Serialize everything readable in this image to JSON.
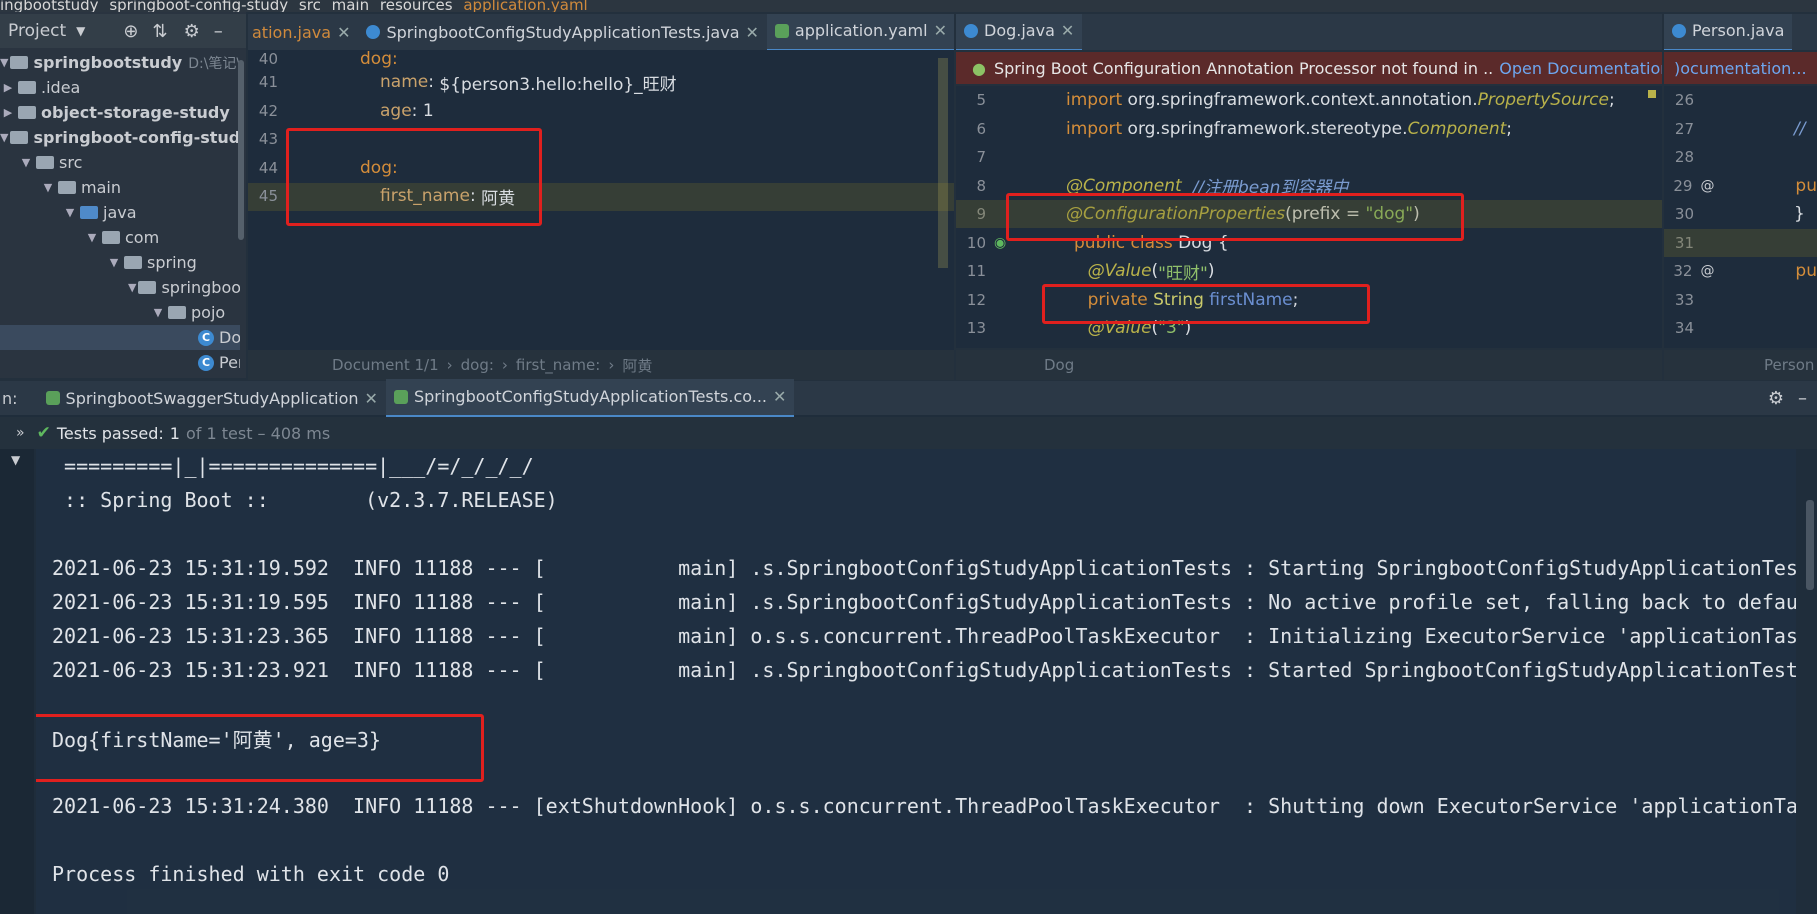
{
  "breadcrumb": [
    "ingbootstudy",
    "springboot-config-study",
    "src",
    "main",
    "resources",
    "application.yaml"
  ],
  "project": {
    "header": "Project",
    "tree": [
      {
        "label": "springbootstudy",
        "suffix": "D:\\笔记\\java\\",
        "type": "folder"
      },
      {
        "label": ".idea",
        "type": "folder"
      },
      {
        "label": "object-storage-study",
        "type": "folder"
      },
      {
        "label": "springboot-config-study",
        "type": "folder"
      },
      {
        "label": "src",
        "type": "folder"
      },
      {
        "label": "main",
        "type": "folder"
      },
      {
        "label": "java",
        "type": "folder"
      },
      {
        "label": "com",
        "type": "folder"
      },
      {
        "label": "spring",
        "type": "folder"
      },
      {
        "label": "springboo",
        "type": "folder"
      },
      {
        "label": "pojo",
        "type": "folder"
      },
      {
        "label": "Do",
        "type": "class"
      },
      {
        "label": "Per",
        "type": "class"
      }
    ]
  },
  "tabs_left": [
    {
      "label": "ation.java"
    },
    {
      "label": "SpringbootConfigStudyApplicationTests.java"
    },
    {
      "label": "application.yaml"
    }
  ],
  "tabs_left_more": "2",
  "tabs_mid": [
    {
      "label": "Dog.java"
    }
  ],
  "tabs_right": [
    {
      "label": "Person.java"
    }
  ],
  "yaml_editor": {
    "lines": [
      {
        "n": "40",
        "text": "dog:"
      },
      {
        "n": "41",
        "key": "name",
        "val": "${person3.hello:hello}_旺财"
      },
      {
        "n": "42",
        "key": "age",
        "val": "1"
      },
      {
        "n": "43",
        "text": ""
      },
      {
        "n": "44",
        "text": "dog:"
      },
      {
        "n": "45",
        "key": "first_name",
        "val": "阿黄"
      }
    ],
    "status": [
      "Document 1/1",
      "dog:",
      "first_name:",
      "阿黄"
    ]
  },
  "dog_editor": {
    "banner": "Spring Boot Configuration Annotation Processor not found in ..",
    "banner_link": "Open Documentation...",
    "lines": [
      {
        "n": "5",
        "a": "import ",
        "b": "org.springframework.context.annotation.",
        "c": "PropertySource",
        "d": ";"
      },
      {
        "n": "6",
        "a": "import ",
        "b": "org.springframework.stereotype.",
        "c": "Component",
        "d": ";"
      },
      {
        "n": "7"
      },
      {
        "n": "8",
        "ann": "@Component",
        "cmt": "  //注册bean到容器中"
      },
      {
        "n": "9",
        "ann": "@ConfigurationProperties",
        "rest": "(prefix = ",
        "str": "\"dog\"",
        "end": ")"
      },
      {
        "n": "10",
        "kw": "public class ",
        "plain": "Dog {"
      },
      {
        "n": "11",
        "ann": "    @Value",
        "rest": "(",
        "str": "\"旺财\"",
        "end": ")"
      },
      {
        "n": "12",
        "kw": "    private ",
        "plain": "String ",
        "fld": "firstName",
        "end": ";"
      },
      {
        "n": "13",
        "ann": "    @Value",
        "rest": "(",
        "str": "\"3\"",
        "end": ")"
      }
    ],
    "status": "Dog"
  },
  "person_editor": {
    "banner_link": ")ocumentation...",
    "lines": [
      {
        "n": "26",
        "code": ""
      },
      {
        "n": "27",
        "code": "//"
      },
      {
        "n": "28",
        "code": ""
      },
      {
        "n": "29",
        "code": "pu"
      },
      {
        "n": "30",
        "code": "}"
      },
      {
        "n": "31",
        "code": ""
      },
      {
        "n": "32",
        "code": "pu"
      },
      {
        "n": "33",
        "code": ""
      },
      {
        "n": "34",
        "code": ""
      }
    ],
    "status": "Person"
  },
  "run": {
    "prefix": "n:",
    "tabs": [
      "SpringbootSwaggerStudyApplication",
      "SpringbootConfigStudyApplicationTests.co..."
    ],
    "tests_passed": "Tests passed:",
    "count": "1",
    "of": "of 1 test – 408 ms",
    "console": [
      " =========|_|==============|___/=/_/_/_/",
      " :: Spring Boot ::        (v2.3.7.RELEASE)",
      "",
      "2021-06-23 15:31:19.592  INFO 11188 --- [           main] .s.SpringbootConfigStudyApplicationTests : Starting SpringbootConfigStudyApplicationTest",
      "2021-06-23 15:31:19.595  INFO 11188 --- [           main] .s.SpringbootConfigStudyApplicationTests : No active profile set, falling back to defaul",
      "2021-06-23 15:31:23.365  INFO 11188 --- [           main] o.s.s.concurrent.ThreadPoolTaskExecutor  : Initializing ExecutorService 'applicationTask",
      "2021-06-23 15:31:23.921  INFO 11188 --- [           main] .s.SpringbootConfigStudyApplicationTests : Started SpringbootConfigStudyApplicationTests",
      "",
      "Dog{firstName='阿黄', age=3}",
      "",
      "2021-06-23 15:31:24.380  INFO 11188 --- [extShutdownHook] o.s.s.concurrent.ThreadPoolTaskExecutor  : Shutting down ExecutorService 'applicationTas",
      "",
      "Process finished with exit code 0"
    ]
  }
}
